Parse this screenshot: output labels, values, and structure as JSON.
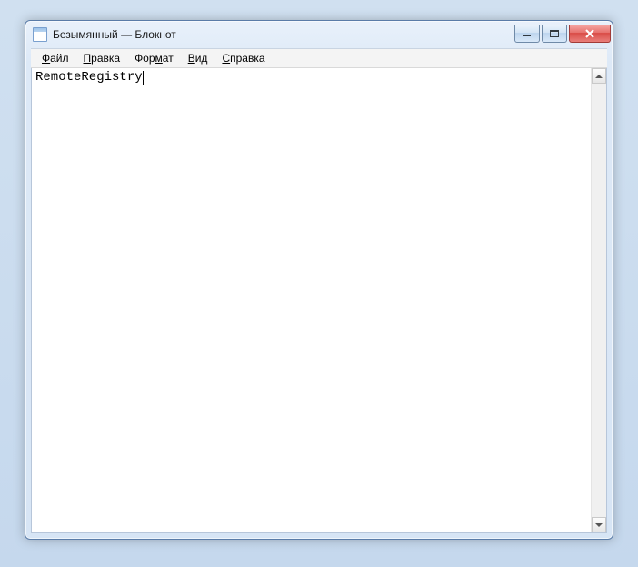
{
  "window": {
    "title": "Безымянный — Блокнот"
  },
  "menu": {
    "file": "Файл",
    "edit": "Правка",
    "format": "Формат",
    "view": "Вид",
    "help": "Справка"
  },
  "editor": {
    "content": "RemoteRegistry"
  }
}
